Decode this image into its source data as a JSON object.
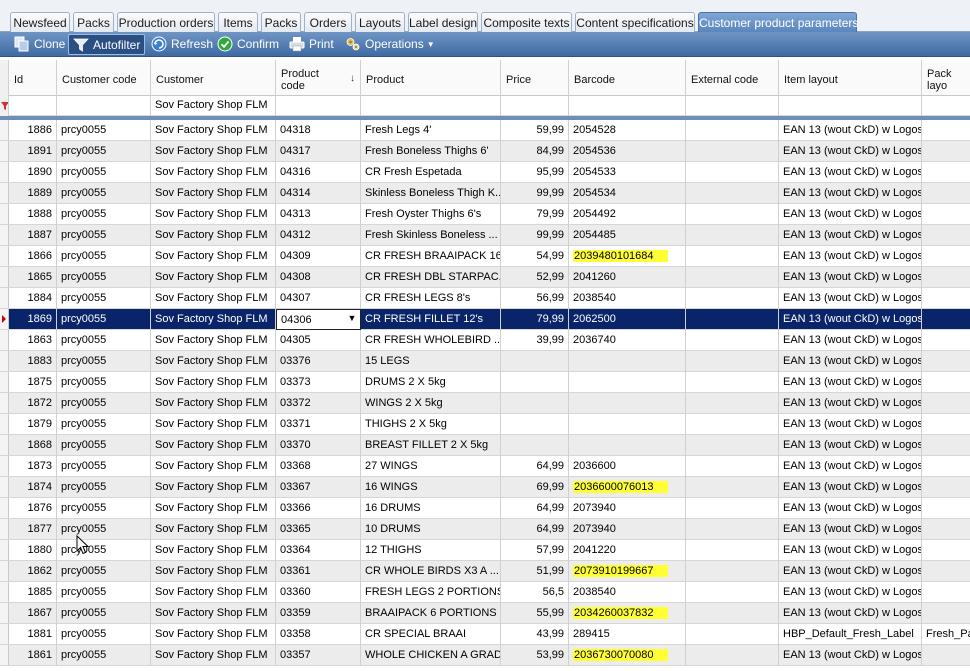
{
  "tabs": [
    {
      "label": "Newsfeed",
      "active": false
    },
    {
      "label": "Packs",
      "active": false
    },
    {
      "label": "Production orders",
      "active": false
    },
    {
      "label": "Items",
      "active": false
    },
    {
      "label": "Packs",
      "active": false
    },
    {
      "label": "Orders",
      "active": false
    },
    {
      "label": "Layouts",
      "active": false
    },
    {
      "label": "Label design",
      "active": false
    },
    {
      "label": "Composite texts",
      "active": false
    },
    {
      "label": "Content specifications",
      "active": false
    },
    {
      "label": "Customer product parameters",
      "active": true
    }
  ],
  "toolbar": {
    "clone": {
      "label": "Clone",
      "icon": "clone-icon"
    },
    "autofilter": {
      "label": "Autofilter",
      "icon": "funnel-icon",
      "pressed": true
    },
    "refresh": {
      "label": "Refresh",
      "icon": "refresh-icon"
    },
    "confirm": {
      "label": "Confirm",
      "icon": "check-icon"
    },
    "print": {
      "label": "Print",
      "icon": "printer-icon"
    },
    "operations": {
      "label": "Operations",
      "icon": "gears-icon"
    }
  },
  "grid": {
    "columns": [
      {
        "key": "id",
        "label": "Id"
      },
      {
        "key": "customer_code",
        "label": "Customer code"
      },
      {
        "key": "customer",
        "label": "Customer"
      },
      {
        "key": "product_code",
        "label": "Product code",
        "sorted": "descending"
      },
      {
        "key": "product",
        "label": "Product"
      },
      {
        "key": "price",
        "label": "Price"
      },
      {
        "key": "barcode",
        "label": "Barcode"
      },
      {
        "key": "external_code",
        "label": "External code"
      },
      {
        "key": "item_layout",
        "label": "Item layout"
      },
      {
        "key": "pack_layout",
        "label": "Pack layo"
      }
    ],
    "filter": {
      "customer": "Sov Factory Shop FLM"
    },
    "highlight_color": "#ffff33",
    "selection_color": "#0a246a",
    "rows": [
      {
        "id": "1886",
        "customer_code": "prcy0055",
        "customer": "Sov Factory Shop FLM",
        "product_code": "04318",
        "product": "Fresh Legs 4'",
        "price": "59,99",
        "barcode": "2054528",
        "external_code": "",
        "item_layout": "EAN 13 (wout CkD) w Logos",
        "pack_layout": "",
        "highlight": false
      },
      {
        "id": "1891",
        "customer_code": "prcy0055",
        "customer": "Sov Factory Shop FLM",
        "product_code": "04317",
        "product": "Fresh Boneless Thighs 6'",
        "price": "84,99",
        "barcode": "2054536",
        "external_code": "",
        "item_layout": "EAN 13 (wout CkD) w Logos",
        "pack_layout": "",
        "highlight": false
      },
      {
        "id": "1890",
        "customer_code": "prcy0055",
        "customer": "Sov Factory Shop FLM",
        "product_code": "04316",
        "product": "CR Fresh Espetada",
        "price": "95,99",
        "barcode": "2054533",
        "external_code": "",
        "item_layout": "EAN 13 (wout CkD) w Logos",
        "pack_layout": "",
        "highlight": false
      },
      {
        "id": "1889",
        "customer_code": "prcy0055",
        "customer": "Sov Factory Shop FLM",
        "product_code": "04314",
        "product": "Skinless Boneless Thigh K...",
        "price": "99,99",
        "barcode": "2054534",
        "external_code": "",
        "item_layout": "EAN 13 (wout CkD) w Logos",
        "pack_layout": "",
        "highlight": false
      },
      {
        "id": "1888",
        "customer_code": "prcy0055",
        "customer": "Sov Factory Shop FLM",
        "product_code": "04313",
        "product": "Fresh Oyster Thighs 6's",
        "price": "79,99",
        "barcode": "2054492",
        "external_code": "",
        "item_layout": "EAN 13 (wout CkD) w Logos",
        "pack_layout": "",
        "highlight": false
      },
      {
        "id": "1887",
        "customer_code": "prcy0055",
        "customer": "Sov Factory Shop FLM",
        "product_code": "04312",
        "product": "Fresh Skinless Boneless ...",
        "price": "99,99",
        "barcode": "2054485",
        "external_code": "",
        "item_layout": "EAN 13 (wout CkD) w Logos",
        "pack_layout": "",
        "highlight": false
      },
      {
        "id": "1866",
        "customer_code": "prcy0055",
        "customer": "Sov Factory Shop FLM",
        "product_code": "04309",
        "product": "CR FRESH BRAAIPACK 16's",
        "price": "54,99",
        "barcode": "2039480101684",
        "external_code": "",
        "item_layout": "EAN 13 (wout CkD) w Logos",
        "pack_layout": "",
        "highlight": true
      },
      {
        "id": "1865",
        "customer_code": "prcy0055",
        "customer": "Sov Factory Shop FLM",
        "product_code": "04308",
        "product": "CR FRESH DBL STARPAC...",
        "price": "52,99",
        "barcode": "2041260",
        "external_code": "",
        "item_layout": "EAN 13 (wout CkD) w Logos",
        "pack_layout": "",
        "highlight": false
      },
      {
        "id": "1884",
        "customer_code": "prcy0055",
        "customer": "Sov Factory Shop FLM",
        "product_code": "04307",
        "product": "CR FRESH LEGS 8's",
        "price": "56,99",
        "barcode": "2038540",
        "external_code": "",
        "item_layout": "EAN 13 (wout CkD) w Logos",
        "pack_layout": "",
        "highlight": false
      },
      {
        "id": "1869",
        "customer_code": "prcy0055",
        "customer": "Sov Factory Shop FLM",
        "product_code": "04306",
        "product": "CR FRESH FILLET 12's",
        "price": "79,99",
        "barcode": "2062500",
        "external_code": "",
        "item_layout": "EAN 13 (wout CkD) w Logos",
        "pack_layout": "",
        "highlight": false,
        "selected": true
      },
      {
        "id": "1863",
        "customer_code": "prcy0055",
        "customer": "Sov Factory Shop FLM",
        "product_code": "04305",
        "product": "CR FRESH WHOLEBIRD ...",
        "price": "39,99",
        "barcode": "2036740",
        "external_code": "",
        "item_layout": "EAN 13 (wout CkD) w Logos",
        "pack_layout": "",
        "highlight": false
      },
      {
        "id": "1883",
        "customer_code": "prcy0055",
        "customer": "Sov Factory Shop FLM",
        "product_code": "03376",
        "product": "15 LEGS",
        "price": "",
        "barcode": "",
        "external_code": "",
        "item_layout": "EAN 13 (wout CkD) w Logos",
        "pack_layout": "",
        "highlight": false
      },
      {
        "id": "1875",
        "customer_code": "prcy0055",
        "customer": "Sov Factory Shop FLM",
        "product_code": "03373",
        "product": "DRUMS 2 X 5kg",
        "price": "",
        "barcode": "",
        "external_code": "",
        "item_layout": "EAN 13 (wout CkD) w Logos",
        "pack_layout": "",
        "highlight": false
      },
      {
        "id": "1872",
        "customer_code": "prcy0055",
        "customer": "Sov Factory Shop FLM",
        "product_code": "03372",
        "product": "WINGS 2 X 5kg",
        "price": "",
        "barcode": "",
        "external_code": "",
        "item_layout": "EAN 13 (wout CkD) w Logos",
        "pack_layout": "",
        "highlight": false
      },
      {
        "id": "1879",
        "customer_code": "prcy0055",
        "customer": "Sov Factory Shop FLM",
        "product_code": "03371",
        "product": "THIGHS 2 X 5kg",
        "price": "",
        "barcode": "",
        "external_code": "",
        "item_layout": "EAN 13 (wout CkD) w Logos",
        "pack_layout": "",
        "highlight": false
      },
      {
        "id": "1868",
        "customer_code": "prcy0055",
        "customer": "Sov Factory Shop FLM",
        "product_code": "03370",
        "product": "BREAST FILLET  2 X 5kg",
        "price": "",
        "barcode": "",
        "external_code": "",
        "item_layout": "EAN 13 (wout CkD) w Logos",
        "pack_layout": "",
        "highlight": false
      },
      {
        "id": "1873",
        "customer_code": "prcy0055",
        "customer": "Sov Factory Shop FLM",
        "product_code": "03368",
        "product": "27 WINGS",
        "price": "64,99",
        "barcode": "2036600",
        "external_code": "",
        "item_layout": "EAN 13 (wout CkD) w Logos",
        "pack_layout": "",
        "highlight": false
      },
      {
        "id": "1874",
        "customer_code": "prcy0055",
        "customer": "Sov Factory Shop FLM",
        "product_code": "03367",
        "product": "16 WINGS",
        "price": "69,99",
        "barcode": "2036600076013",
        "external_code": "",
        "item_layout": "EAN 13 (wout CkD) w Logos",
        "pack_layout": "",
        "highlight": true
      },
      {
        "id": "1876",
        "customer_code": "prcy0055",
        "customer": "Sov Factory Shop FLM",
        "product_code": "03366",
        "product": "16 DRUMS",
        "price": "64,99",
        "barcode": "2073940",
        "external_code": "",
        "item_layout": "EAN 13 (wout CkD) w Logos",
        "pack_layout": "",
        "highlight": false
      },
      {
        "id": "1877",
        "customer_code": "prcy0055",
        "customer": "Sov Factory Shop FLM",
        "product_code": "03365",
        "product": "10 DRUMS",
        "price": "64,99",
        "barcode": "2073940",
        "external_code": "",
        "item_layout": "EAN 13 (wout CkD) w Logos",
        "pack_layout": "",
        "highlight": false
      },
      {
        "id": "1880",
        "customer_code": "prcy0055",
        "customer": "Sov Factory Shop FLM",
        "product_code": "03364",
        "product": "12 THIGHS",
        "price": "57,99",
        "barcode": "2041220",
        "external_code": "",
        "item_layout": "EAN 13 (wout CkD) w Logos",
        "pack_layout": "",
        "highlight": false
      },
      {
        "id": "1862",
        "customer_code": "prcy0055",
        "customer": "Sov Factory Shop FLM",
        "product_code": "03361",
        "product": "CR WHOLE BIRDS X3 A ...",
        "price": "51,99",
        "barcode": "2073910199667",
        "external_code": "",
        "item_layout": "EAN 13 (wout CkD) w Logos",
        "pack_layout": "",
        "highlight": true
      },
      {
        "id": "1885",
        "customer_code": "prcy0055",
        "customer": "Sov Factory Shop FLM",
        "product_code": "03360",
        "product": "FRESH LEGS 2 PORTIONS",
        "price": "56,5",
        "barcode": "2038540",
        "external_code": "",
        "item_layout": "EAN 13 (wout CkD) w Logos",
        "pack_layout": "",
        "highlight": false
      },
      {
        "id": "1867",
        "customer_code": "prcy0055",
        "customer": "Sov Factory Shop FLM",
        "product_code": "03359",
        "product": "BRAAIPACK 6 PORTIONS",
        "price": "55,99",
        "barcode": "2034260037832",
        "external_code": "",
        "item_layout": "EAN 13 (wout CkD) w Logos",
        "pack_layout": "",
        "highlight": true
      },
      {
        "id": "1881",
        "customer_code": "prcy0055",
        "customer": "Sov Factory Shop FLM",
        "product_code": "03358",
        "product": "CR SPECIAL BRAAI",
        "price": "43,99",
        "barcode": "289415",
        "external_code": "",
        "item_layout": "HBP_Default_Fresh_Label",
        "pack_layout": "Fresh_Pa",
        "highlight": false
      },
      {
        "id": "1861",
        "customer_code": "prcy0055",
        "customer": "Sov Factory Shop FLM",
        "product_code": "03357",
        "product": "WHOLE CHICKEN A GRADE",
        "price": "53,99",
        "barcode": "2036730070080",
        "external_code": "",
        "item_layout": "EAN 13 (wout CkD) w Logos",
        "pack_layout": "",
        "highlight": true
      }
    ]
  }
}
